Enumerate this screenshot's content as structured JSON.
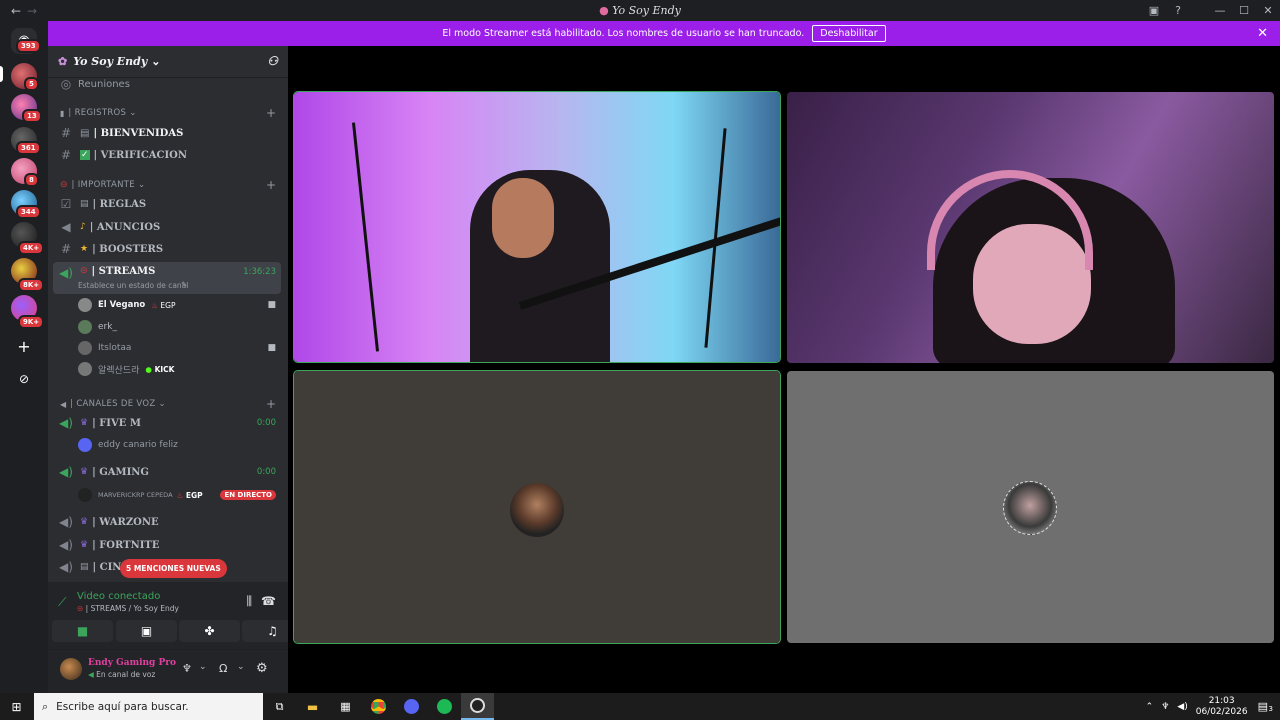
{
  "window": {
    "title": "Yo Soy Endy"
  },
  "banner": {
    "text": "El modo Streamer está habilitado. Los nombres de usuario se han truncado.",
    "button": "Deshabilitar"
  },
  "guilds": {
    "home_badge": "393",
    "badges": [
      "5",
      "13",
      "361",
      "8",
      "344",
      "4K+",
      "8K+",
      "9K+"
    ]
  },
  "server": {
    "name": "Yo Soy Endy",
    "partial_item": "Reuniones",
    "categories": {
      "registros": "| REGISTROS",
      "importante": "| IMPORTANTE",
      "voz": "| CANALES DE VOZ"
    },
    "channels": {
      "bienvenidas": "| BIENVENIDAS",
      "verificacion": "| VERIFICACION",
      "reglas": "| REGLAS",
      "anuncios": "| ANUNCIOS",
      "boosters": "| BOOSTERS",
      "streams": "| STREAMS",
      "streams_timer": "1:36:23",
      "streams_status": "Establece un estado de canal",
      "fivem": "| FIVE M",
      "fivem_timer": "0:00",
      "gaming": "| GAMING",
      "gaming_timer": "0:00",
      "warzone": "| WARZONE",
      "fortnite": "| FORTNITE",
      "cine": "| CIN"
    },
    "streams_users": [
      {
        "name": "El Vegano",
        "tag": "EGP"
      },
      {
        "name": "erk_",
        "tag": ""
      },
      {
        "name": "Itslotaa",
        "tag": ""
      },
      {
        "name": "알렉산드라",
        "tag": "KICK"
      }
    ],
    "fivem_user": "eddy canario feliz",
    "gaming_user": {
      "name": "MARVERICKRP CEPEDA",
      "tag": "EGP",
      "live": "EN DIRECTO"
    },
    "mentions": "5 MENCIONES NUEVAS"
  },
  "voice": {
    "status": "Video conectado",
    "channel": "| STREAMS / Yo Soy Endy"
  },
  "user": {
    "name": "Endy Gaming Pro",
    "status": "En canal de voz"
  },
  "taskbar": {
    "search_placeholder": "Escribe aquí para buscar.",
    "time": "21:03",
    "date": "06/02/2026",
    "notif": "3"
  },
  "colors": {
    "accent": "#9b1fe8",
    "danger": "#da373c",
    "speaking": "#3ba55c"
  }
}
